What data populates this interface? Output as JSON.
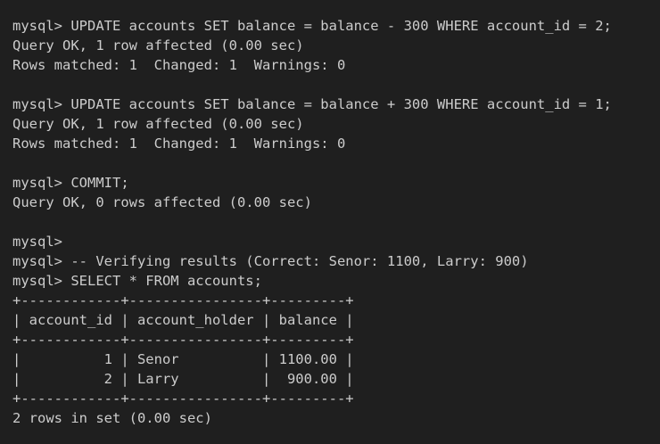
{
  "terminal": {
    "lines": [
      "mysql> UPDATE accounts SET balance = balance - 300 WHERE account_id = 2;",
      "Query OK, 1 row affected (0.00 sec)",
      "Rows matched: 1  Changed: 1  Warnings: 0",
      "",
      "mysql> UPDATE accounts SET balance = balance + 300 WHERE account_id = 1;",
      "Query OK, 1 row affected (0.00 sec)",
      "Rows matched: 1  Changed: 1  Warnings: 0",
      "",
      "mysql> COMMIT;",
      "Query OK, 0 rows affected (0.00 sec)",
      "",
      "mysql>",
      "mysql> -- Verifying results (Correct: Senor: 1100, Larry: 900)",
      "mysql> SELECT * FROM accounts;",
      "+------------+----------------+---------+",
      "| account_id | account_holder | balance |",
      "+------------+----------------+---------+",
      "|          1 | Senor          | 1100.00 |",
      "|          2 | Larry          |  900.00 |",
      "+------------+----------------+---------+",
      "2 rows in set (0.00 sec)"
    ]
  },
  "colors": {
    "background": "#1f1f1f",
    "text": "#cccccc"
  }
}
